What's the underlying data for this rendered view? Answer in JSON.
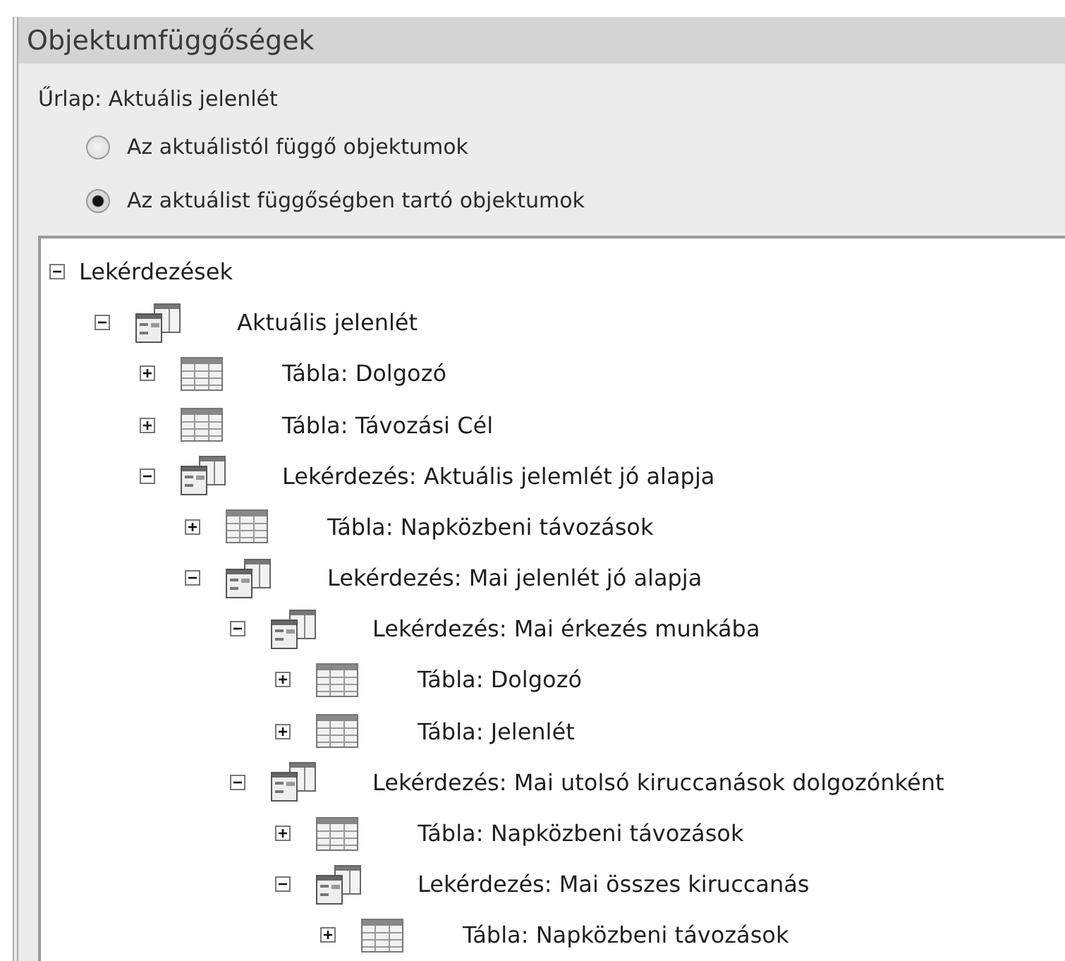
{
  "panel": {
    "title": "Objektumfüggőségek"
  },
  "object_label": "Űrlap: Aktuális jelenlét",
  "options": [
    {
      "label": "Az aktuálistól függő objektumok",
      "selected": false
    },
    {
      "label": "Az aktuálist függőségben tartó objektumok",
      "selected": true
    }
  ],
  "tree": [
    {
      "label": "Lekérdezések",
      "expanded": true,
      "children": [
        {
          "label": "Aktuális jelenlét",
          "kind": "query",
          "expanded": true,
          "children": [
            {
              "label": "Tábla: Dolgozó",
              "kind": "table",
              "expanded": false
            },
            {
              "label": "Tábla: Távozási Cél",
              "kind": "table",
              "expanded": false
            },
            {
              "label": "Lekérdezés: Aktuális jelemlét jó alapja",
              "kind": "query",
              "expanded": true,
              "children": [
                {
                  "label": "Tábla: Napközbeni távozások",
                  "kind": "table",
                  "expanded": false
                },
                {
                  "label": "Lekérdezés: Mai jelenlét jó alapja",
                  "kind": "query",
                  "expanded": true,
                  "children": [
                    {
                      "label": "Lekérdezés: Mai érkezés munkába",
                      "kind": "query",
                      "expanded": true,
                      "children": [
                        {
                          "label": "Tábla: Dolgozó",
                          "kind": "table",
                          "expanded": false
                        },
                        {
                          "label": "Tábla: Jelenlét",
                          "kind": "table",
                          "expanded": false
                        }
                      ]
                    },
                    {
                      "label": "Lekérdezés: Mai utolsó kiruccanások dolgozónként",
                      "kind": "query",
                      "expanded": true,
                      "children": [
                        {
                          "label": "Tábla: Napközbeni távozások",
                          "kind": "table",
                          "expanded": false
                        },
                        {
                          "label": "Lekérdezés: Mai összes kiruccanás",
                          "kind": "query",
                          "expanded": true,
                          "children": [
                            {
                              "label": "Tábla: Napközbeni távozások",
                              "kind": "table",
                              "expanded": false
                            }
                          ]
                        }
                      ]
                    }
                  ]
                }
              ]
            }
          ]
        }
      ]
    }
  ]
}
